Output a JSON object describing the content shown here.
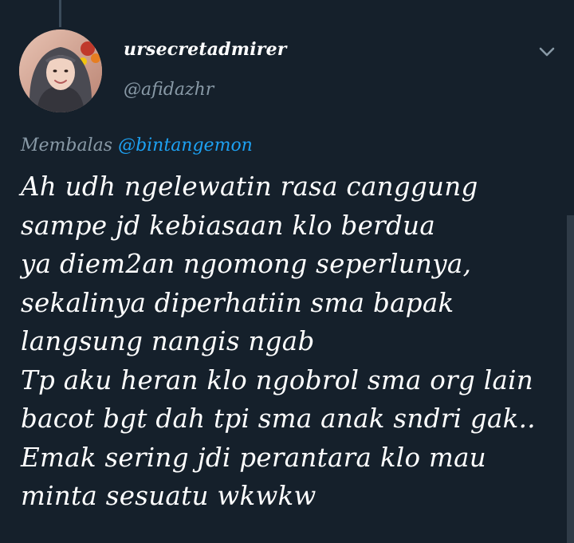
{
  "tweet": {
    "display_name": "ursecretadmirer",
    "handle": "@afidazhr",
    "reply_prefix": "Membalas",
    "reply_to": "@bintangemon",
    "text": "Ah udh ngelewatin rasa canggung\nsampe jd kebiasaan klo berdua\nya diem2an ngomong seperlunya,\nsekalinya diperhatiin sma bapak\nlangsung nangis ngab\nTp aku heran klo ngobrol sma org lain\nbacot bgt dah tpi sma anak sndri gak..\nEmak sering jdi perantara klo mau\nminta sesuatu wkwkw"
  },
  "icons": {
    "menu": "chevron-down-icon",
    "avatar": "profile-photo"
  },
  "colors": {
    "background": "#15202b",
    "text": "#ffffff",
    "secondary_text": "#8899a6",
    "link": "#1da1f2"
  }
}
